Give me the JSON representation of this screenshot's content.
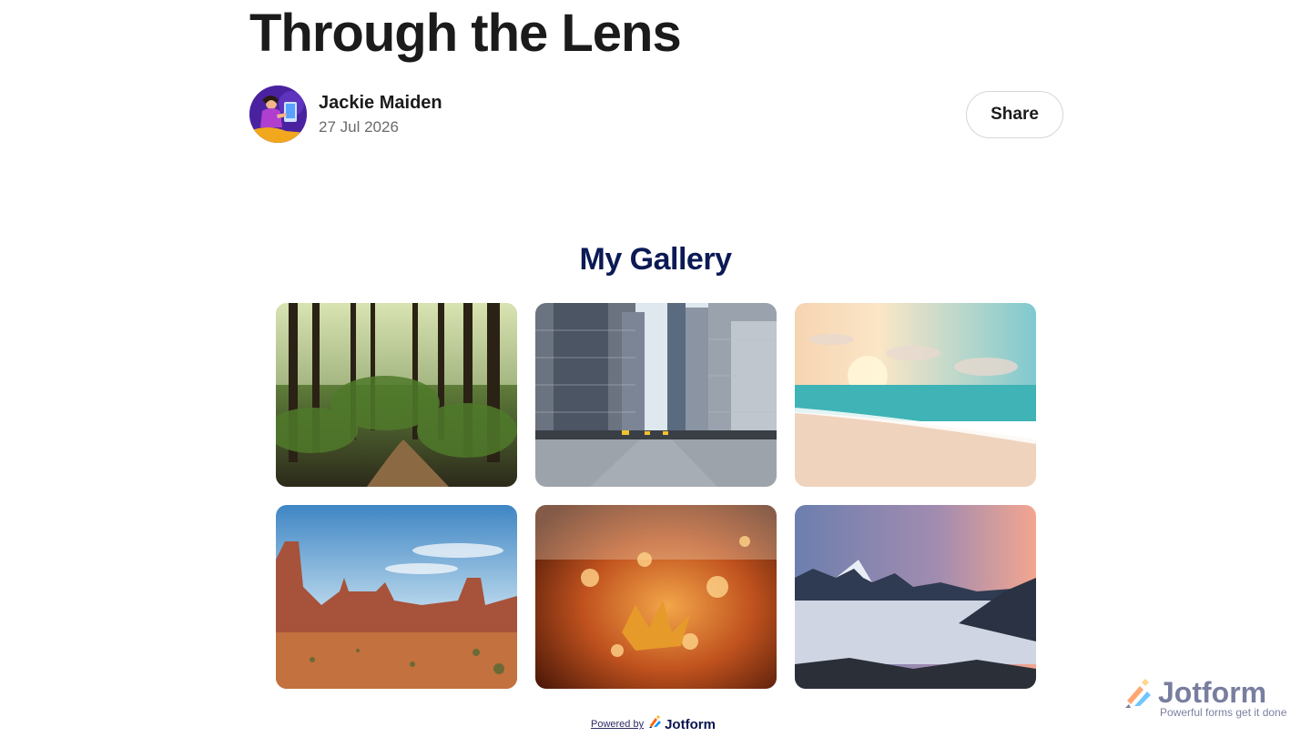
{
  "post": {
    "title": "Through the Lens",
    "author_name": "Jackie Maiden",
    "date": "27 Jul 2026",
    "share_label": "Share"
  },
  "gallery": {
    "title": "My Gallery",
    "images": [
      {
        "subject": "forest path"
      },
      {
        "subject": "city street with skyscrapers"
      },
      {
        "subject": "beach at sunset"
      },
      {
        "subject": "desert buttes"
      },
      {
        "subject": "autumn leaves"
      },
      {
        "subject": "mountains above clouds"
      }
    ]
  },
  "footer": {
    "powered_text": "Powered by",
    "brand": "Jotform"
  },
  "badge": {
    "brand": "Jotform",
    "tagline": "Powerful forms get it done"
  },
  "colors": {
    "heading": "#1b1b1b",
    "gallery_title": "#0b1a55",
    "brand_navy": "#0a1551"
  }
}
